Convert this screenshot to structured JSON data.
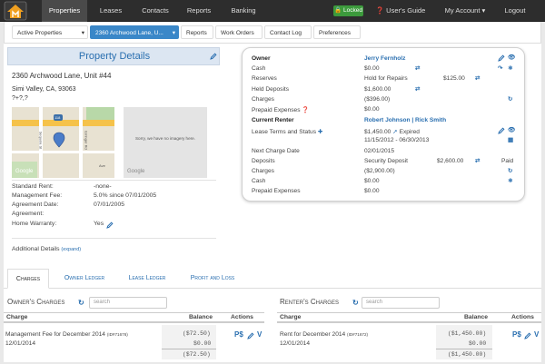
{
  "nav": {
    "items": [
      {
        "label": "Properties",
        "active": true
      },
      {
        "label": "Leases"
      },
      {
        "label": "Contacts"
      },
      {
        "label": "Reports"
      },
      {
        "label": "Banking"
      }
    ],
    "locked_label": "Locked",
    "users_guide": "User's Guide",
    "my_account": "My Account",
    "logout": "Logout"
  },
  "subnav": {
    "active_properties": "Active Properties",
    "selected_property": "2360 Archwood Lane, U...",
    "reports": "Reports",
    "work_orders": "Work Orders",
    "contact_log": "Contact Log",
    "preferences": "Preferences"
  },
  "property": {
    "title": "Property Details",
    "address1": "2360 Archwood Lane, Unit #44",
    "address2": "Simi Valley, CA, 93063",
    "address3": "?+?,?",
    "no_imagery": "Sorry, we have no imagery here.",
    "google_label": "Google",
    "map_labels": {
      "highway": "118",
      "street1": "Sequoia St",
      "street2": "Erringer Rd",
      "street3": "Ave"
    },
    "standard_rent_label": "Standard Rent:",
    "standard_rent_value": "-none-",
    "mgmt_fee_label": "Management Fee:",
    "mgmt_fee_value": "5.0% since 07/01/2005",
    "agreement_date_label": "Agreement Date:",
    "agreement_date_value": "07/01/2005",
    "agreement_label": "Agreement:",
    "home_warranty_label": "Home Warranty:",
    "home_warranty_value": "Yes",
    "additional_details": "Additional Details",
    "expand": "(expand)"
  },
  "owner": {
    "owner_label": "Owner",
    "owner_name": "Jerry Fernholz",
    "cash_label": "Cash",
    "cash_value": "$0.00",
    "reserves_label": "Reserves",
    "reserves_note": "Hold for Repairs",
    "reserves_value": "$125.00",
    "held_deposits_label": "Held Deposits",
    "held_deposits_value": "$1,600.00",
    "charges_label": "Charges",
    "charges_value": "($396.00)",
    "prepaid_label": "Prepaid Expenses",
    "prepaid_value": "$0.00"
  },
  "renter": {
    "current_renter_label": "Current Renter",
    "renter_names": "Robert Johnson | Rick Smith",
    "lease_terms_label": "Lease Terms and Status",
    "lease_amount": "$1,450.00",
    "lease_status": "Expired",
    "lease_dates": "11/15/2012 - 06/30/2013",
    "next_charge_label": "Next Charge Date",
    "next_charge_value": "02/01/2015",
    "deposits_label": "Deposits",
    "deposits_note": "Security Deposit",
    "deposits_value": "$2,600.00",
    "deposits_status": "Paid",
    "charges_label": "Charges",
    "charges_value": "($2,900.00)",
    "cash_label": "Cash",
    "cash_value": "$0.00",
    "prepaid_label": "Prepaid Expenses",
    "prepaid_value": "$0.00"
  },
  "tabs": [
    {
      "label": "Charges",
      "active": true
    },
    {
      "label": "Owner Ledger"
    },
    {
      "label": "Lease Ledger"
    },
    {
      "label": "Profit and Loss"
    }
  ],
  "owners_charges": {
    "title": "Owner's Charges",
    "search_placeholder": "search",
    "col_charge": "Charge",
    "col_balance": "Balance",
    "col_actions": "Actions",
    "row": {
      "desc": "Management Fee for December 2014",
      "id": "(ID#71676)",
      "date": "12/01/2014",
      "amount": "($72.50)",
      "paid": "$0.00",
      "balance": "($72.50)"
    }
  },
  "renters_charges": {
    "title": "Renter's Charges",
    "search_placeholder": "search",
    "col_charge": "Charge",
    "col_balance": "Balance",
    "col_actions": "Actions",
    "row": {
      "desc": "Rent for December 2014",
      "id": "(ID#71672)",
      "date": "12/01/2014",
      "amount": "($1,450.00)",
      "paid": "$0.00",
      "balance": "($1,450.00)"
    }
  },
  "colors": {
    "accent": "#2a6fb0",
    "nav_bg": "#2d2d2d",
    "locked": "#3c9a3c",
    "selected": "#3a87c8"
  }
}
